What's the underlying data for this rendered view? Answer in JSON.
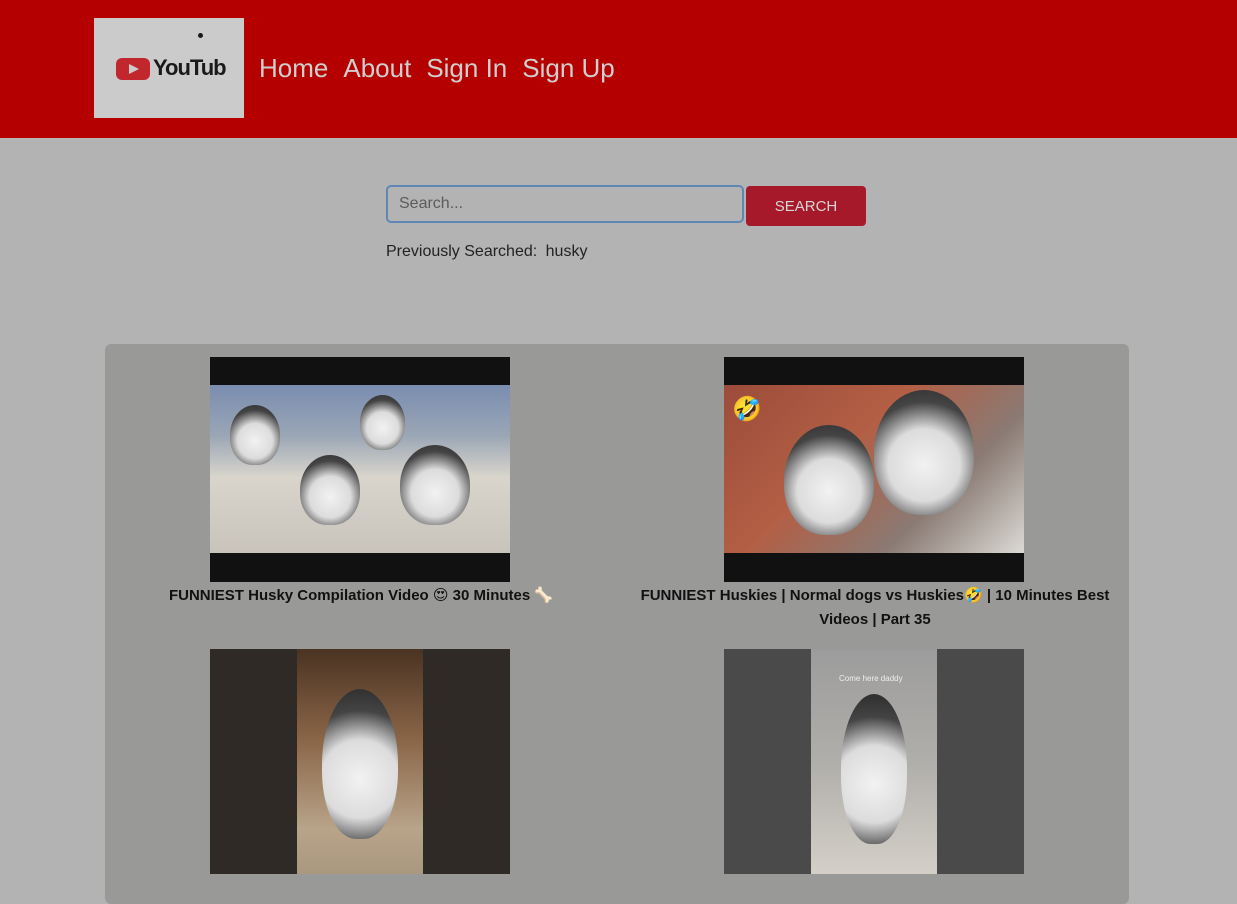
{
  "header": {
    "logo_text": "YouTub",
    "nav": [
      {
        "label": "Home"
      },
      {
        "label": "About"
      },
      {
        "label": "Sign In"
      },
      {
        "label": "Sign Up"
      }
    ]
  },
  "search": {
    "placeholder": "Search...",
    "value": "",
    "button_label": "SEARCH",
    "previously_searched_label": "Previously Searched:",
    "previously_searched_value": "husky"
  },
  "videos": [
    {
      "title": "FUNNIEST Husky Compilation Video 😍 30 Minutes 🦴",
      "thumbnail_icon": "husky-group-thumbnail"
    },
    {
      "title": "FUNNIEST Huskies | Normal dogs vs Huskies🤣 | 10 Minutes Best Videos | Part 35",
      "thumbnail_icon": "husky-pair-thumbnail",
      "thumbnail_emoji": "🤣"
    },
    {
      "title": "",
      "thumbnail_icon": "husky-howling-thumbnail"
    },
    {
      "title": "",
      "thumbnail_icon": "husky-sitting-thumbnail",
      "thumbnail_caption": "Come here daddy"
    }
  ],
  "colors": {
    "navbar": "#b50000",
    "search_button": "#a5192b",
    "page_background": "#b3b3b3",
    "results_panel": "#999a98"
  }
}
